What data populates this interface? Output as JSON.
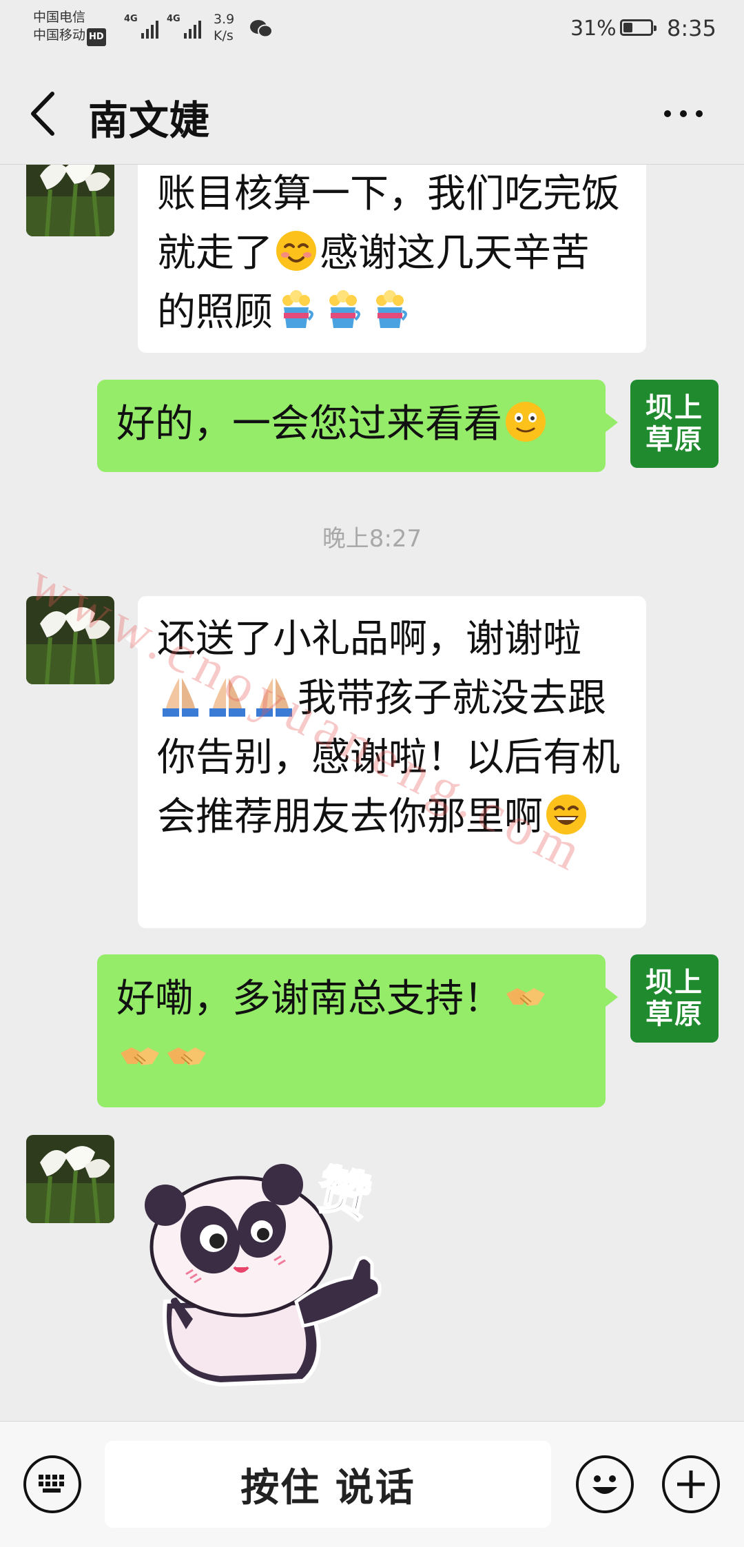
{
  "status_bar": {
    "carrier1": "中国电信",
    "carrier2": "中国移动",
    "hd": "HD",
    "net_type1": "4G",
    "net_type2": "4G",
    "speed_value": "3.9",
    "speed_unit": "K/s",
    "battery": "31%",
    "battery_level": 0.31,
    "time": "8:35"
  },
  "header": {
    "title": "南文婕"
  },
  "avatar_right": {
    "line1": "坝上",
    "line2": "草原"
  },
  "messages": {
    "m1": {
      "text1": "账目核算一下，我们吃完饭就走了",
      "text2": "感谢这几天辛苦的照顾"
    },
    "m2": {
      "text": "好的，一会您过来看看"
    },
    "timestamp": "晚上8:27",
    "m3": {
      "text1": "还送了小礼品啊，谢谢啦",
      "text2": "我带孩子就没去跟你告别，感谢啦！以后有机会推荐朋友去你那里啊"
    },
    "m4": {
      "text": "好嘞，多谢南总支持！"
    },
    "m5_sticker_text": "赞"
  },
  "watermark": "www.cnoyuaneng.com",
  "input_bar": {
    "voice_label": "按住 说话"
  },
  "icons": [
    "back-icon",
    "more-icon",
    "keyboard-icon",
    "emoji-icon",
    "plus-icon",
    "wechat-icon"
  ]
}
